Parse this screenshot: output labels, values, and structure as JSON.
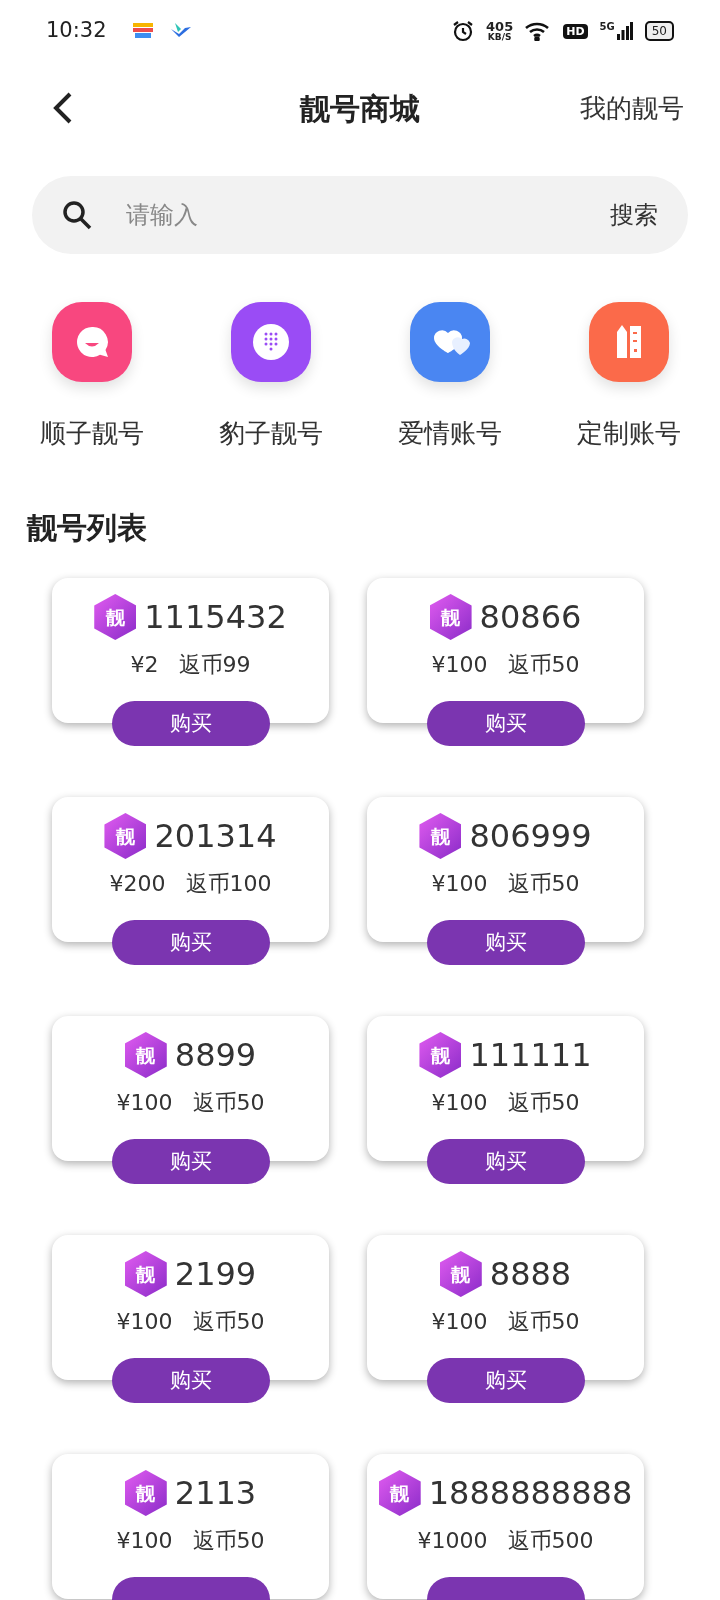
{
  "status_bar": {
    "time": "10:32",
    "net_speed": "405",
    "net_unit": "KB/S",
    "hd": "HD",
    "network": "5G",
    "battery": "50"
  },
  "header": {
    "title": "靓号商城",
    "action": "我的靓号"
  },
  "search": {
    "placeholder": "请输入",
    "button": "搜索"
  },
  "categories": [
    {
      "label": "顺子靓号",
      "kind": "chat",
      "color": "#f8477f"
    },
    {
      "label": "豹子靓号",
      "kind": "dialpad",
      "color": "#9a4cf5"
    },
    {
      "label": "爱情账号",
      "kind": "hearts",
      "color": "#4a86f2"
    },
    {
      "label": "定制账号",
      "kind": "tools",
      "color": "#fb6a4a"
    }
  ],
  "section_title": "靓号列表",
  "cards": [
    {
      "badge": "靓",
      "number": "1115432",
      "price": "¥2",
      "rebate": "返币99",
      "buy": "购买"
    },
    {
      "badge": "靓",
      "number": "80866",
      "price": "¥100",
      "rebate": "返币50",
      "buy": "购买"
    },
    {
      "badge": "靓",
      "number": "201314",
      "price": "¥200",
      "rebate": "返币100",
      "buy": "购买"
    },
    {
      "badge": "靓",
      "number": "806999",
      "price": "¥100",
      "rebate": "返币50",
      "buy": "购买"
    },
    {
      "badge": "靓",
      "number": "8899",
      "price": "¥100",
      "rebate": "返币50",
      "buy": "购买"
    },
    {
      "badge": "靓",
      "number": "111111",
      "price": "¥100",
      "rebate": "返币50",
      "buy": "购买"
    },
    {
      "badge": "靓",
      "number": "2199",
      "price": "¥100",
      "rebate": "返币50",
      "buy": "购买"
    },
    {
      "badge": "靓",
      "number": "8888",
      "price": "¥100",
      "rebate": "返币50",
      "buy": "购买"
    },
    {
      "badge": "靓",
      "number": "2113",
      "price": "¥100",
      "rebate": "返币50"
    },
    {
      "badge": "靓",
      "number": "1888888888",
      "price": "¥1000",
      "rebate": "返币500"
    }
  ]
}
